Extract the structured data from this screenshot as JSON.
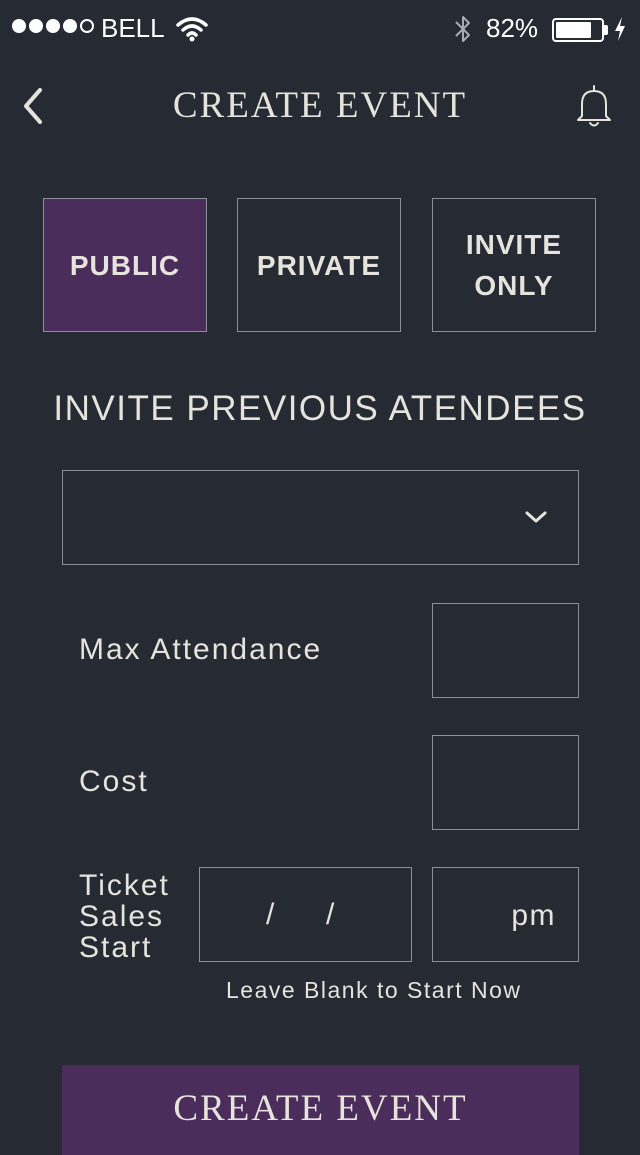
{
  "status_bar": {
    "carrier": "BELL",
    "signal_bars_filled": 4,
    "signal_bars_total": 5,
    "battery_percent_label": "82%",
    "battery_level": 0.82,
    "icons": [
      "wifi-icon",
      "bluetooth-icon",
      "battery-icon",
      "charging-bolt-icon"
    ]
  },
  "nav": {
    "title": "CREATE EVENT",
    "back_icon": "chevron-left-icon",
    "notification_icon": "bell-icon"
  },
  "visibility": {
    "options": [
      {
        "label": "PUBLIC",
        "selected": true
      },
      {
        "label": "PRIVATE",
        "selected": false
      },
      {
        "label": "INVITE\nONLY",
        "selected": false
      }
    ]
  },
  "invite": {
    "heading": "INVITE PREVIOUS ATENDEES",
    "dropdown_value": "",
    "dropdown_icon": "chevron-down-icon"
  },
  "form": {
    "max_attendance_label": "Max Attendance",
    "max_attendance_value": "",
    "cost_label": "Cost",
    "cost_value": "",
    "ticket_sales_label": "Ticket\nSales\nStart",
    "date_separator": "/",
    "time_suffix": "pm",
    "hint": "Leave Blank to Start Now"
  },
  "actions": {
    "create_label": "CREATE EVENT"
  },
  "colors": {
    "background": "#262b33",
    "accent": "#4b2d5c",
    "text": "#e6e3dc",
    "border": "#8b8f96"
  }
}
